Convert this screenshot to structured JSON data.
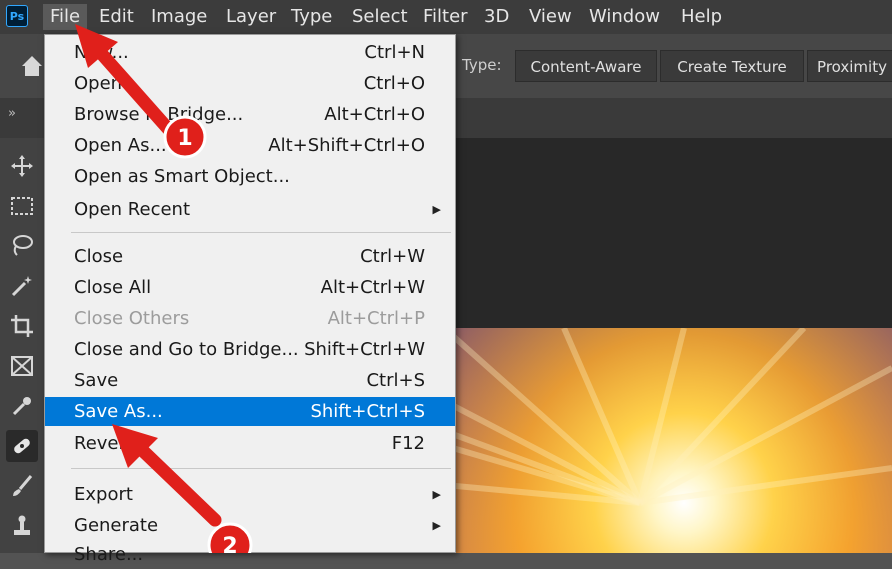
{
  "app": {
    "logo_text": "Ps"
  },
  "menubar": {
    "items": [
      "File",
      "Edit",
      "Image",
      "Layer",
      "Type",
      "Select",
      "Filter",
      "3D",
      "View",
      "Window",
      "Help"
    ]
  },
  "options_bar": {
    "type_label": "Type:",
    "buttons": [
      "Content-Aware",
      "Create Texture",
      "Proximity"
    ]
  },
  "file_menu": {
    "items": [
      {
        "label": "New...",
        "shortcut": "Ctrl+N"
      },
      {
        "label": "Open...",
        "shortcut": "Ctrl+O"
      },
      {
        "label": "Browse in Bridge...",
        "shortcut": "Alt+Ctrl+O"
      },
      {
        "label": "Open As...",
        "shortcut": "Alt+Shift+Ctrl+O"
      },
      {
        "label": "Open as Smart Object...",
        "shortcut": ""
      },
      {
        "label": "Open Recent",
        "shortcut": ""
      },
      {
        "label": "Close",
        "shortcut": "Ctrl+W"
      },
      {
        "label": "Close All",
        "shortcut": "Alt+Ctrl+W"
      },
      {
        "label": "Close Others",
        "shortcut": "Alt+Ctrl+P"
      },
      {
        "label": "Close and Go to Bridge...",
        "shortcut": "Shift+Ctrl+W"
      },
      {
        "label": "Save",
        "shortcut": "Ctrl+S"
      },
      {
        "label": "Save As...",
        "shortcut": "Shift+Ctrl+S"
      },
      {
        "label": "Revert",
        "shortcut": "F12"
      },
      {
        "label": "Export",
        "shortcut": ""
      },
      {
        "label": "Generate",
        "shortcut": ""
      },
      {
        "label": "Share...",
        "shortcut": ""
      }
    ]
  },
  "annotations": {
    "step1": "1",
    "step2": "2",
    "arrow_color": "#e0201b"
  },
  "colors": {
    "highlight": "#0078d7",
    "menu_bg": "#f0f0f0",
    "ps_blue": "#31a8ff"
  }
}
